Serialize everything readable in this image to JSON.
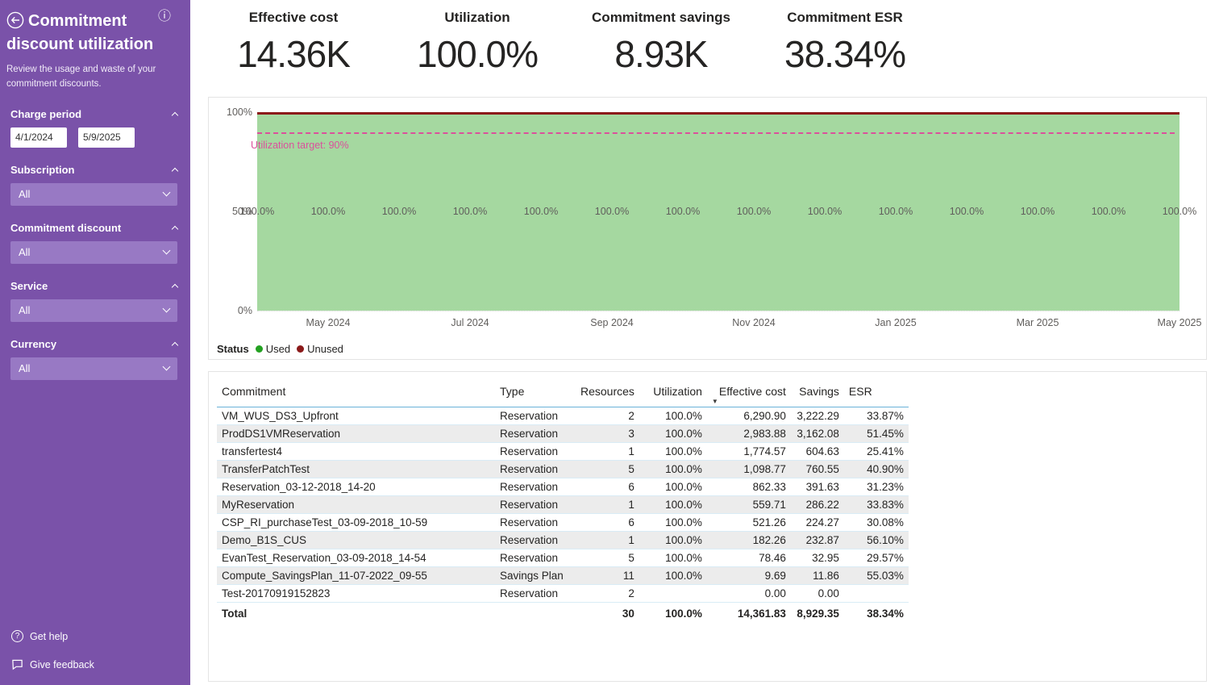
{
  "theme": {
    "sidebar_bg": "#7A52A9",
    "dropdown_bg": "#9879C4"
  },
  "sidebar": {
    "title": "Commitment discount utilization",
    "subtitle": "Review the usage and waste of your commitment discounts.",
    "filters": {
      "charge_period": {
        "label": "Charge period",
        "from": "4/1/2024",
        "to": "5/9/2025"
      },
      "subscription": {
        "label": "Subscription",
        "value": "All"
      },
      "commitment_discount": {
        "label": "Commitment discount",
        "value": "All"
      },
      "service": {
        "label": "Service",
        "value": "All"
      },
      "currency": {
        "label": "Currency",
        "value": "All"
      }
    },
    "footer": {
      "get_help": "Get help",
      "give_feedback": "Give feedback"
    }
  },
  "kpis": [
    {
      "label": "Effective cost",
      "value": "14.36K"
    },
    {
      "label": "Utilization",
      "value": "100.0%"
    },
    {
      "label": "Commitment savings",
      "value": "8.93K"
    },
    {
      "label": "Commitment ESR",
      "value": "38.34%"
    }
  ],
  "chart_data": {
    "type": "area",
    "title": "",
    "x": [
      "Apr 2024",
      "May 2024",
      "Jun 2024",
      "Jul 2024",
      "Aug 2024",
      "Sep 2024",
      "Oct 2024",
      "Nov 2024",
      "Dec 2024",
      "Jan 2025",
      "Feb 2025",
      "Mar 2025",
      "Apr 2025",
      "May 2025"
    ],
    "series": [
      {
        "name": "Used",
        "color": "#23A121",
        "fill": "#A5D8A0",
        "values": [
          100,
          100,
          100,
          100,
          100,
          100,
          100,
          100,
          100,
          100,
          100,
          100,
          100,
          100
        ]
      },
      {
        "name": "Unused",
        "color": "#8B1A1A",
        "values": [
          0,
          0,
          0,
          0,
          0,
          0,
          0,
          0,
          0,
          0,
          0,
          0,
          0,
          0
        ]
      }
    ],
    "ylim": [
      0,
      100
    ],
    "y_ticks": [
      "0%",
      "50%",
      "100%"
    ],
    "x_ticks": [
      "May 2024",
      "Jul 2024",
      "Sep 2024",
      "Nov 2024",
      "Jan 2025",
      "Mar 2025",
      "May 2025"
    ],
    "target": {
      "label": "Utilization target: 90%",
      "value": 90,
      "color": "#DB509C"
    },
    "data_label_suffix": "%",
    "legend": {
      "title": "Status",
      "position": "bottom"
    }
  },
  "table": {
    "columns": [
      {
        "key": "commitment",
        "label": "Commitment",
        "align": "left"
      },
      {
        "key": "type",
        "label": "Type",
        "align": "left"
      },
      {
        "key": "resources",
        "label": "Resources",
        "align": "right"
      },
      {
        "key": "utilization",
        "label": "Utilization",
        "align": "right"
      },
      {
        "key": "effective-cost",
        "label": "Effective cost",
        "align": "right",
        "sorted": "desc"
      },
      {
        "key": "savings",
        "label": "Savings",
        "align": "right"
      },
      {
        "key": "esr",
        "label": "ESR",
        "align": "right",
        "header_align": "left"
      }
    ],
    "rows": [
      [
        "VM_WUS_DS3_Upfront",
        "Reservation",
        "2",
        "100.0%",
        "6,290.90",
        "3,222.29",
        "33.87%"
      ],
      [
        "ProdDS1VMReservation",
        "Reservation",
        "3",
        "100.0%",
        "2,983.88",
        "3,162.08",
        "51.45%"
      ],
      [
        "transfertest4",
        "Reservation",
        "1",
        "100.0%",
        "1,774.57",
        "604.63",
        "25.41%"
      ],
      [
        "TransferPatchTest",
        "Reservation",
        "5",
        "100.0%",
        "1,098.77",
        "760.55",
        "40.90%"
      ],
      [
        "Reservation_03-12-2018_14-20",
        "Reservation",
        "6",
        "100.0%",
        "862.33",
        "391.63",
        "31.23%"
      ],
      [
        "MyReservation",
        "Reservation",
        "1",
        "100.0%",
        "559.71",
        "286.22",
        "33.83%"
      ],
      [
        "CSP_RI_purchaseTest_03-09-2018_10-59",
        "Reservation",
        "6",
        "100.0%",
        "521.26",
        "224.27",
        "30.08%"
      ],
      [
        "Demo_B1S_CUS",
        "Reservation",
        "1",
        "100.0%",
        "182.26",
        "232.87",
        "56.10%"
      ],
      [
        "EvanTest_Reservation_03-09-2018_14-54",
        "Reservation",
        "5",
        "100.0%",
        "78.46",
        "32.95",
        "29.57%"
      ],
      [
        "Compute_SavingsPlan_11-07-2022_09-55",
        "Savings Plan",
        "11",
        "100.0%",
        "9.69",
        "11.86",
        "55.03%"
      ],
      [
        "Test-20170919152823",
        "Reservation",
        "2",
        "",
        "0.00",
        "0.00",
        ""
      ]
    ],
    "total": [
      "Total",
      "",
      "30",
      "100.0%",
      "14,361.83",
      "8,929.35",
      "38.34%"
    ]
  }
}
